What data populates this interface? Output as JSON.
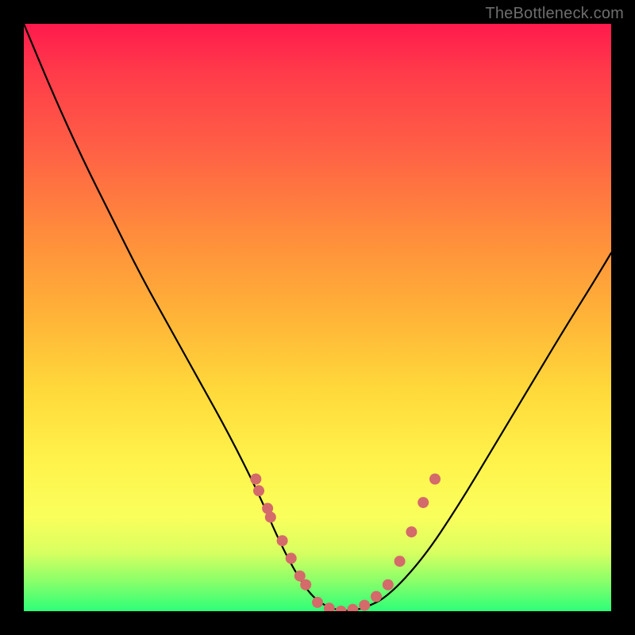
{
  "watermark": "TheBottleneck.com",
  "chart_data": {
    "type": "line",
    "title": "",
    "xlabel": "",
    "ylabel": "",
    "xlim": [
      0,
      1
    ],
    "ylim": [
      0,
      1
    ],
    "series": [
      {
        "name": "bottleneck-curve",
        "x": [
          0.0,
          0.05,
          0.1,
          0.15,
          0.2,
          0.25,
          0.3,
          0.35,
          0.4,
          0.43,
          0.46,
          0.49,
          0.52,
          0.55,
          0.58,
          0.62,
          0.68,
          0.74,
          0.8,
          0.86,
          0.92,
          0.97,
          1.0
        ],
        "y": [
          1.0,
          0.88,
          0.77,
          0.67,
          0.57,
          0.48,
          0.39,
          0.3,
          0.2,
          0.13,
          0.07,
          0.025,
          0.005,
          0.0,
          0.005,
          0.025,
          0.09,
          0.18,
          0.28,
          0.38,
          0.48,
          0.56,
          0.61
        ]
      }
    ],
    "markers": {
      "name": "highlight-dots",
      "color": "#d46a6a",
      "x": [
        0.395,
        0.4,
        0.415,
        0.42,
        0.44,
        0.455,
        0.47,
        0.48,
        0.5,
        0.52,
        0.54,
        0.56,
        0.58,
        0.6,
        0.62,
        0.64,
        0.66,
        0.68,
        0.7
      ],
      "y": [
        0.225,
        0.205,
        0.175,
        0.16,
        0.12,
        0.09,
        0.06,
        0.045,
        0.015,
        0.005,
        0.0,
        0.003,
        0.01,
        0.025,
        0.045,
        0.085,
        0.135,
        0.185,
        0.225
      ]
    },
    "background_gradient": [
      "#ff1a4d",
      "#ff8a3c",
      "#fff24a",
      "#2dff78"
    ]
  }
}
